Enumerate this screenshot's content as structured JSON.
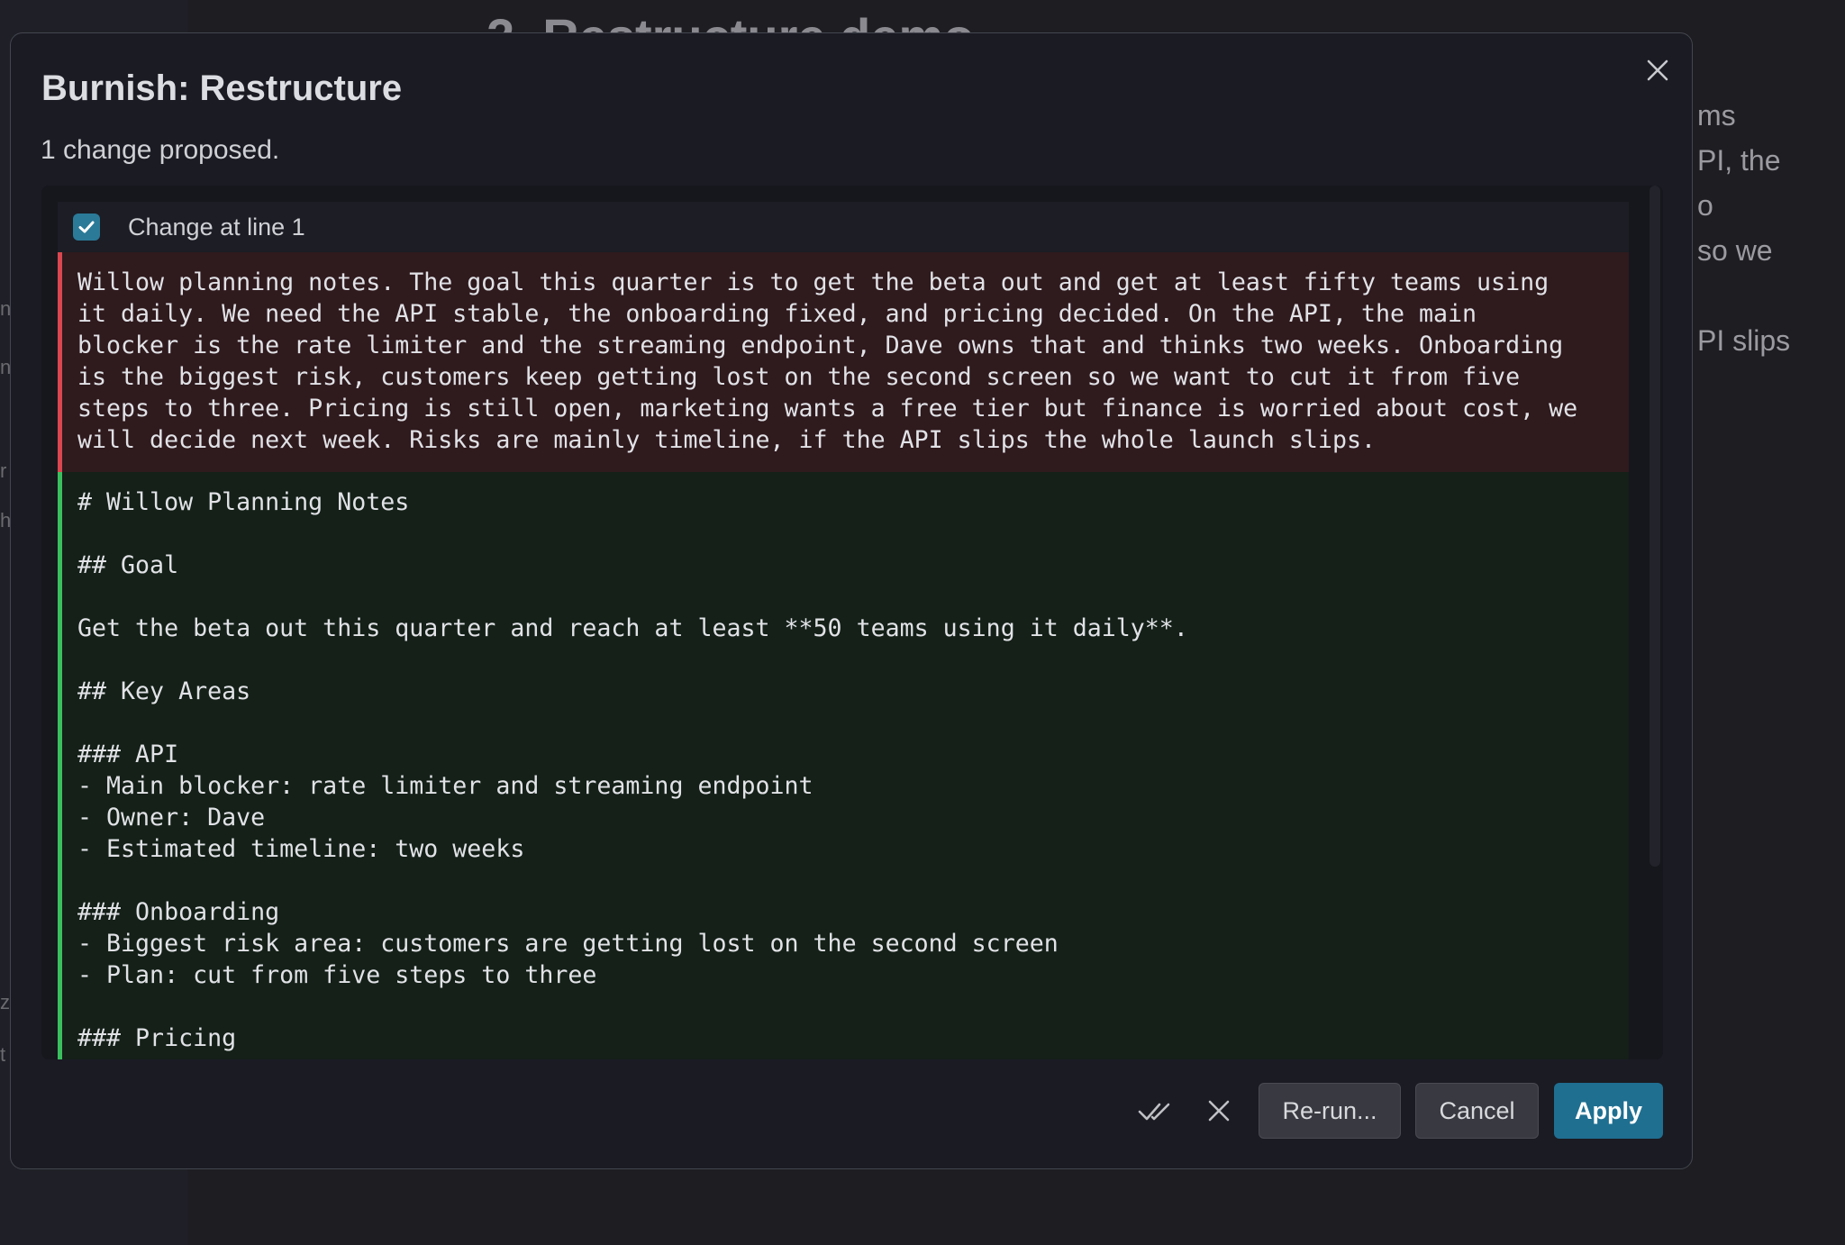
{
  "background": {
    "heading": "2. Restructure demo",
    "side_text": [
      "ms",
      "PI, the",
      "o",
      "so we",
      "PI slips"
    ]
  },
  "dialog": {
    "title": "Burnish: Restructure",
    "subtitle": "1 change proposed.",
    "close_icon": "close-icon"
  },
  "change": {
    "label": "Change at line 1",
    "checked": true,
    "removed_text": "Willow planning notes. The goal this quarter is to get the beta out and get at least fifty teams using\nit daily. We need the API stable, the onboarding fixed, and pricing decided. On the API, the main\nblocker is the rate limiter and the streaming endpoint, Dave owns that and thinks two weeks. Onboarding\nis the biggest risk, customers keep getting lost on the second screen so we want to cut it from five\nsteps to three. Pricing is still open, marketing wants a free tier but finance is worried about cost, we\nwill decide next week. Risks are mainly timeline, if the API slips the whole launch slips.",
    "added_text": "# Willow Planning Notes\n\n## Goal\n\nGet the beta out this quarter and reach at least **50 teams using it daily**.\n\n## Key Areas\n\n### API\n- Main blocker: rate limiter and streaming endpoint\n- Owner: Dave\n- Estimated timeline: two weeks\n\n### Onboarding\n- Biggest risk area: customers are getting lost on the second screen\n- Plan: cut from five steps to three\n\n### Pricing"
  },
  "footer": {
    "accept_all_icon": "double-check-icon",
    "reject_all_icon": "close-icon",
    "rerun_label": "Re-run...",
    "cancel_label": "Cancel",
    "apply_label": "Apply"
  },
  "colors": {
    "accent": "#1f6f91",
    "removed_border": "#d9474f",
    "added_border": "#3bbf5e",
    "removed_bg": "#2f1a1e",
    "added_bg": "#142018"
  }
}
